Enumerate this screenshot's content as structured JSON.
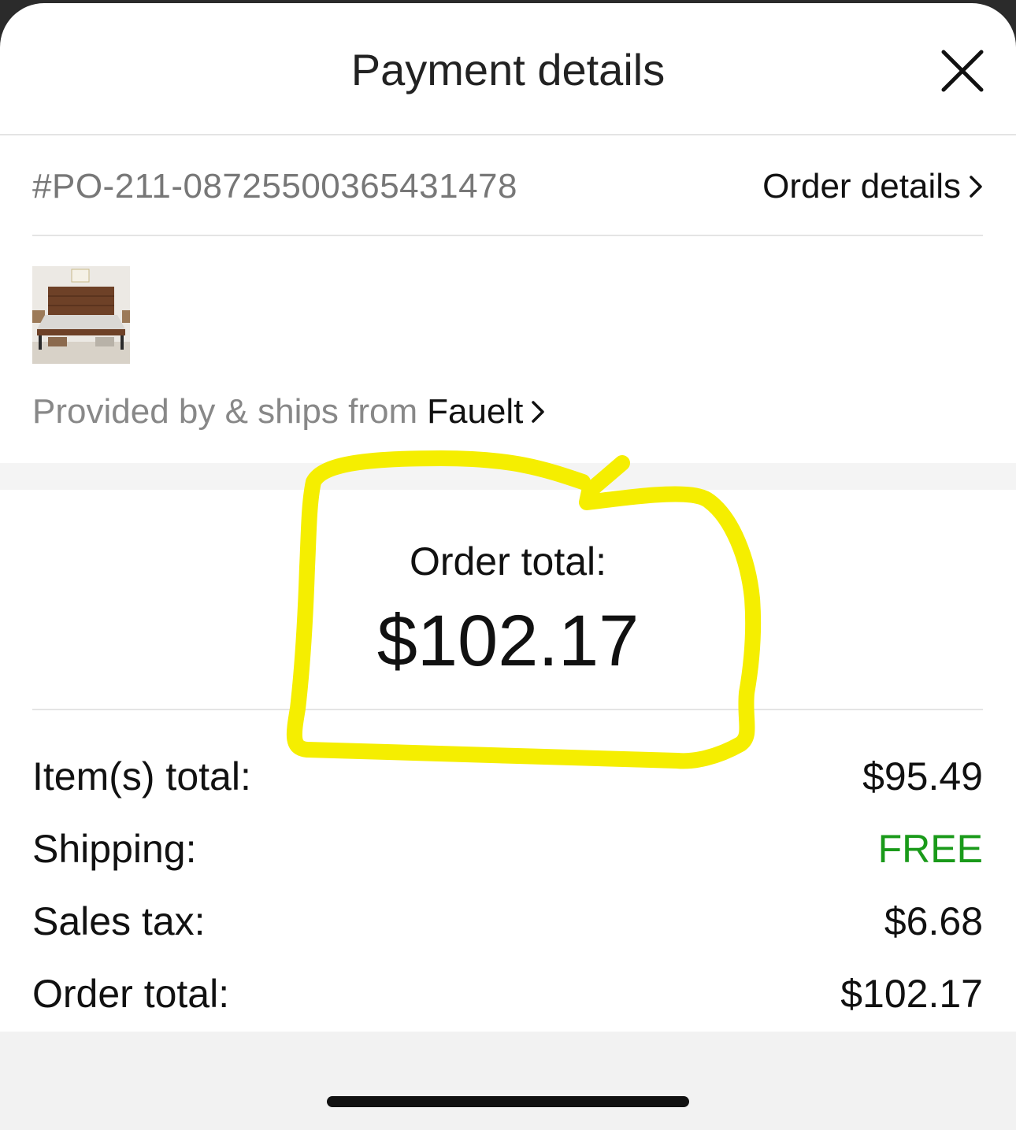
{
  "header": {
    "title": "Payment details",
    "close_icon": "close-icon"
  },
  "order": {
    "id": "#PO-211-08725500365431478",
    "details_link": "Order details",
    "chevron_icon": "chevron-right-icon"
  },
  "product": {
    "thumbnail": "bed-frame-product-image"
  },
  "seller": {
    "prefix": "Provided by & ships from",
    "name": "Fauelt"
  },
  "total_highlight": {
    "label": "Order total:",
    "value": "$102.17"
  },
  "summary": {
    "rows": [
      {
        "label": "Item(s) total:",
        "value": "$95.49"
      },
      {
        "label": "Shipping:",
        "value": "FREE"
      },
      {
        "label": "Sales tax:",
        "value": "$6.68"
      },
      {
        "label": "Order total:",
        "value": "$102.17"
      }
    ]
  },
  "colors": {
    "free_green": "#1a9a1a",
    "highlight_yellow": "#f5ee00"
  }
}
